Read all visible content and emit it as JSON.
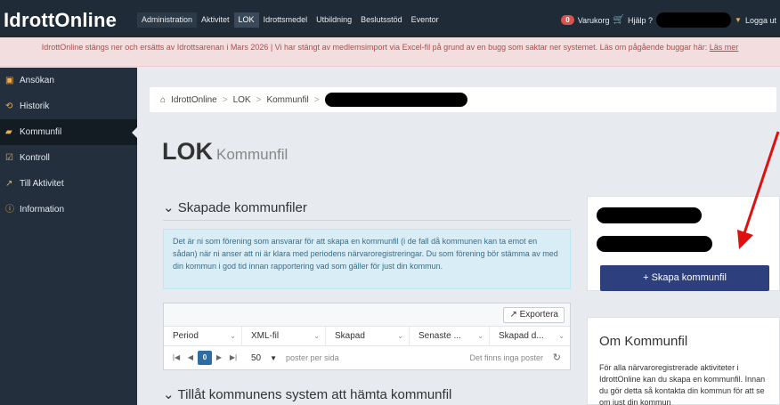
{
  "topbar": {
    "logo_text": "IdrottOnline",
    "nav": [
      "Administration",
      "Aktivitet",
      "LOK",
      "Idrottsmedel",
      "Utbildning",
      "Beslutsstöd",
      "Eventor"
    ],
    "active_nav": "LOK",
    "cart_count": "0",
    "cart_label": "Varukorg",
    "help_label": "Hjälp ?",
    "logout_label": "Logga ut"
  },
  "banner": {
    "text": "IdrottOnline stängs ner och ersätts av Idrottsarenan i Mars 2026 | Vi har stängt av medlemsimport via Excel-fil på grund av en bugg som saktar ner systemet. Läs om pågående buggar här:",
    "link": "Läs mer"
  },
  "sidebar": {
    "items": [
      {
        "label": "Ansökan",
        "icon": "file-icon",
        "glyph": "▣"
      },
      {
        "label": "Historik",
        "icon": "history-icon",
        "glyph": "⟲"
      },
      {
        "label": "Kommunfil",
        "icon": "folder-icon",
        "glyph": "▰"
      },
      {
        "label": "Kontroll",
        "icon": "check-icon",
        "glyph": "☑"
      },
      {
        "label": "Till Aktivitet",
        "icon": "external-link-icon",
        "glyph": "↗"
      },
      {
        "label": "Information",
        "icon": "info-icon",
        "glyph": "ⓘ"
      }
    ],
    "active_index": 2
  },
  "breadcrumb": {
    "home": "IdrottOnline",
    "items": [
      "LOK",
      "Kommunfil"
    ]
  },
  "page": {
    "title": "LOK",
    "subtitle": "Kommunfil"
  },
  "sections": {
    "created": "Skapade kommunfiler",
    "allow": "Tillåt kommunens system att hämta kommunfil"
  },
  "info_text": "Det är ni som förening som ansvarar för att skapa en kommunfil (i de fall då kommunen kan ta emot en sådan) när ni anser att ni är klara med periodens närvaroregistreringar. Du som förening bör stämma av med din kommun i god tid innan rapportering vad som gäller för just din kommun.",
  "grid": {
    "export_label": "Exportera",
    "columns": [
      "Period",
      "XML-fil",
      "Skapad",
      "Senaste ...",
      "Skapad d..."
    ],
    "pager": {
      "current_page": "0",
      "page_size": "50",
      "page_size_label": "poster per sida",
      "empty_text": "Det finns inga poster"
    }
  },
  "right_panel": {
    "create_button": "Skapa kommunfil"
  },
  "about": {
    "title": "Om Kommunfil",
    "text": "För alla närvaroregistrerade aktiviteter i IdrottOnline kan du skapa en kommunfil. Innan du gör detta så kontakta din kommun för att se om just din kommun"
  },
  "colors": {
    "topbar": "#1f2b37",
    "sidebar": "#232f3c",
    "banner_bg": "#f2dede",
    "banner_text": "#b8494a",
    "primary_button": "#2e3f7e",
    "info_bg": "#d9edf7",
    "annotation_arrow": "#e01010"
  }
}
